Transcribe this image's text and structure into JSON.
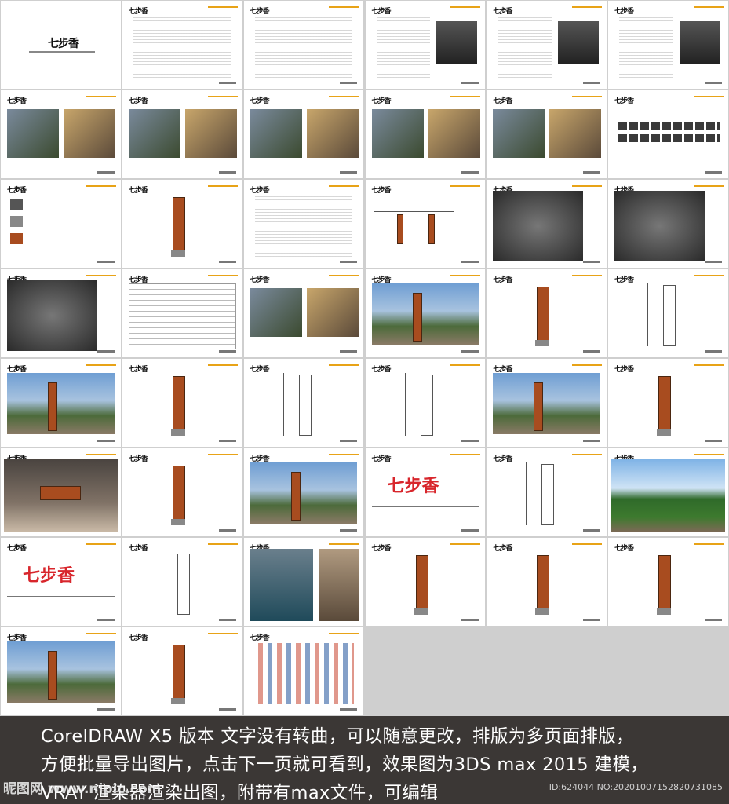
{
  "pages": [
    {
      "kind": "cover"
    },
    {
      "kind": "text"
    },
    {
      "kind": "text"
    },
    {
      "kind": "text-photo"
    },
    {
      "kind": "text-photo"
    },
    {
      "kind": "text-photo"
    },
    {
      "kind": "photos"
    },
    {
      "kind": "photos"
    },
    {
      "kind": "photos"
    },
    {
      "kind": "photos"
    },
    {
      "kind": "photos"
    },
    {
      "kind": "icons"
    },
    {
      "kind": "materials"
    },
    {
      "kind": "sign"
    },
    {
      "kind": "text"
    },
    {
      "kind": "diagram"
    },
    {
      "kind": "map"
    },
    {
      "kind": "map"
    },
    {
      "kind": "map"
    },
    {
      "kind": "table"
    },
    {
      "kind": "photos"
    },
    {
      "kind": "photo"
    },
    {
      "kind": "sign"
    },
    {
      "kind": "drawing"
    },
    {
      "kind": "photo"
    },
    {
      "kind": "sign"
    },
    {
      "kind": "drawing"
    },
    {
      "kind": "drawing"
    },
    {
      "kind": "photo"
    },
    {
      "kind": "sign"
    },
    {
      "kind": "arch"
    },
    {
      "kind": "sign"
    },
    {
      "kind": "photo"
    },
    {
      "kind": "chars"
    },
    {
      "kind": "drawing"
    },
    {
      "kind": "trees"
    },
    {
      "kind": "chars"
    },
    {
      "kind": "drawing"
    },
    {
      "kind": "door"
    },
    {
      "kind": "sign"
    },
    {
      "kind": "sign"
    },
    {
      "kind": "sign"
    },
    {
      "kind": "photo"
    },
    {
      "kind": "sign"
    },
    {
      "kind": "logos"
    }
  ],
  "banner": {
    "line1": "CorelDRAW X5 版本  文字没有转曲，可以随意更改，排版为多页面排版，",
    "line2": "方便批量导出图片，点击下一页就可看到，效果图为3DS max 2015 建模，",
    "line3": "VRAY 渲染器渲染出图，附带有max文件，可编辑"
  },
  "watermark": {
    "site": "昵图网 www.nipic.com",
    "id": "ID:624044 NO:20201007152820731085"
  },
  "colors": {
    "accent": "#e8a317",
    "wood": "#a84c1f",
    "red": "#d8262c"
  }
}
